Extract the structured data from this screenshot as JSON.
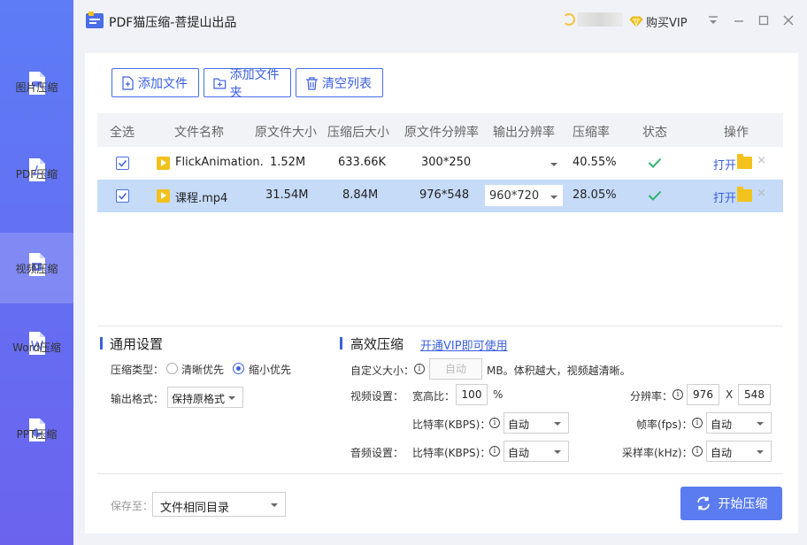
{
  "app": {
    "title": "PDF猫压缩-菩提山出品",
    "vip_buy": "购买VIP"
  },
  "sidebar": {
    "items": [
      {
        "label": "图片压缩",
        "icon": "image-file-icon"
      },
      {
        "label": "PDF压缩",
        "icon": "pdf-file-icon"
      },
      {
        "label": "视频压缩",
        "icon": "video-file-icon",
        "active": true
      },
      {
        "label": "Word压缩",
        "icon": "word-file-icon"
      },
      {
        "label": "PPT压缩",
        "icon": "ppt-file-icon"
      }
    ]
  },
  "toolbar": {
    "add_file": "添加文件",
    "add_folder": "添加文件夹",
    "clear_list": "清空列表"
  },
  "table": {
    "headers": [
      "全选",
      "文件名称",
      "原文件大小",
      "压缩后大小",
      "原文件分辨率",
      "输出分辨率",
      "压缩率",
      "状态",
      "操作"
    ],
    "rows": [
      {
        "name": "FlickAnimation.",
        "orig_size": "1.52M",
        "new_size": "633.66K",
        "orig_res": "300*250",
        "out_res": "",
        "ratio": "40.55%",
        "open": "打开",
        "checked": true,
        "selected": false
      },
      {
        "name": "课程.mp4",
        "orig_size": "31.54M",
        "new_size": "8.84M",
        "orig_res": "976*548",
        "out_res": "960*720",
        "ratio": "28.05%",
        "open": "打开",
        "checked": true,
        "selected": true
      }
    ]
  },
  "general": {
    "title": "通用设置",
    "type_label": "压缩类型：",
    "type_options": [
      "清晰优先",
      "缩小优先"
    ],
    "type_selected": "缩小优先",
    "format_label": "输出格式：",
    "format_value": "保持原格式"
  },
  "advanced": {
    "title": "高效压缩",
    "vip_link": "开通VIP即可使用",
    "custom_size_label": "自定义大小：",
    "custom_size_value": "自动",
    "custom_size_hint": "MB。体积越大，视频越清晰。",
    "video_label": "视频设置：",
    "aspect_label": "宽高比：",
    "aspect_value": "100",
    "aspect_unit": "%",
    "resolution_label": "分辨率：",
    "res_w": "976",
    "res_x": "X",
    "res_h": "548",
    "vbitrate_label": "比特率(KBPS)：",
    "vbitrate_value": "自动",
    "fps_label": "帧率(fps)：",
    "fps_value": "自动",
    "audio_label": "音频设置：",
    "abitrate_label": "比特率(KBPS)：",
    "abitrate_value": "自动",
    "samplerate_label": "采样率(kHz)：",
    "samplerate_value": "自动",
    "info_glyph": "i"
  },
  "footer": {
    "save_label": "保存至：",
    "save_value": "文件相同目录",
    "start": "开始压缩"
  },
  "colors": {
    "accent": "#3a5fe0",
    "sidebar_top": "#5d7cf6",
    "sidebar_bottom": "#6b63ee",
    "selected_row": "#c5dbf8",
    "check_green": "#2bb36b"
  }
}
